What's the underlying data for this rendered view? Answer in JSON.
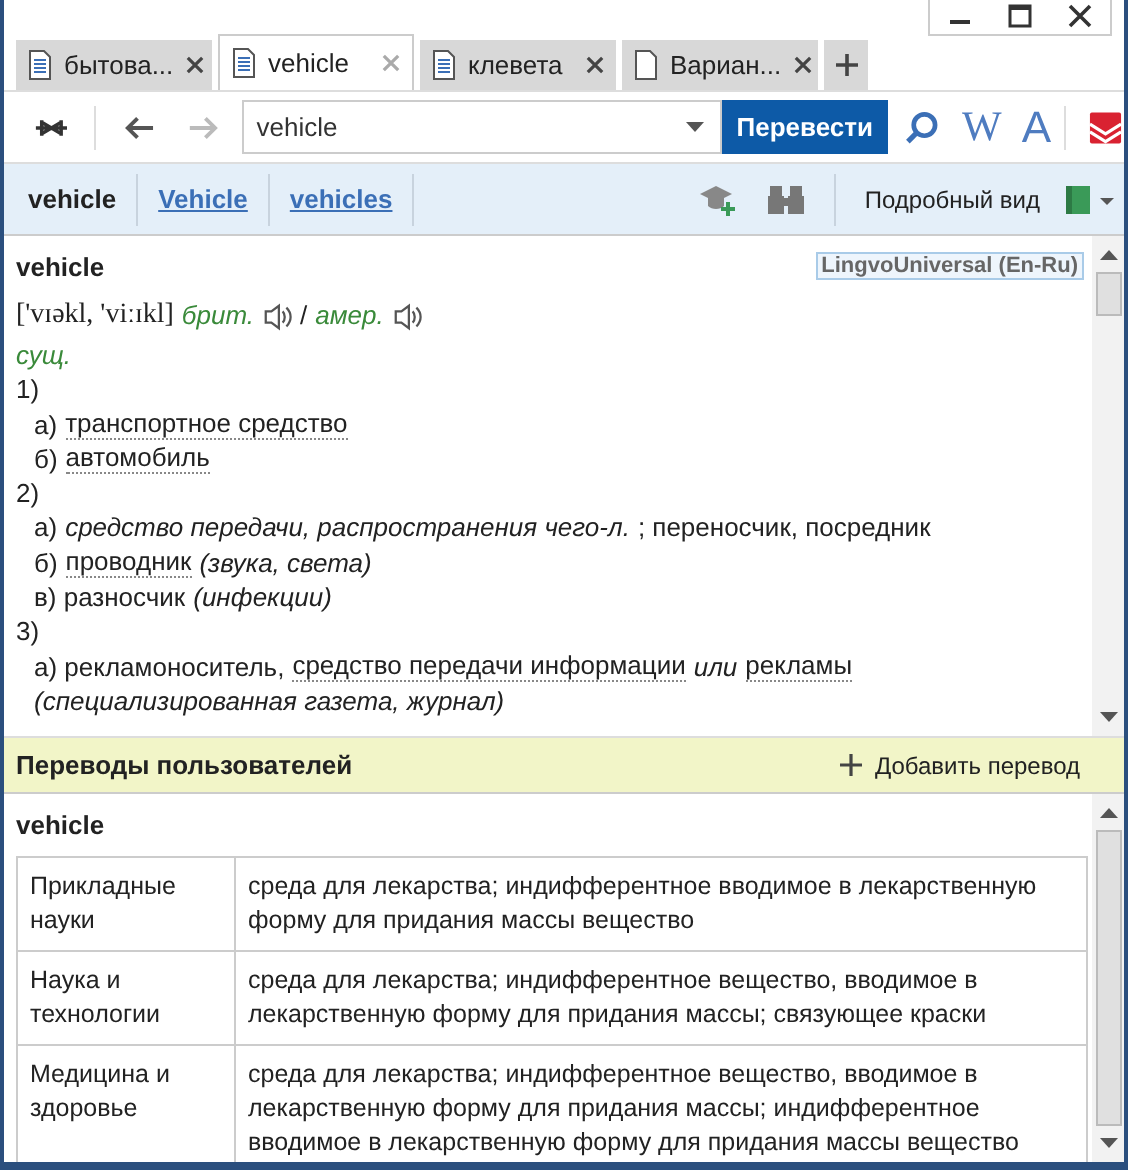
{
  "tabs": [
    {
      "label": "бытова...",
      "kind": "article",
      "selected": false
    },
    {
      "label": "vehicle",
      "kind": "article",
      "selected": true
    },
    {
      "label": "клевета",
      "kind": "article",
      "selected": false
    },
    {
      "label": "Вариан...",
      "kind": "blank",
      "selected": false
    }
  ],
  "toolbar": {
    "forward_disabled": true,
    "search": {
      "value": "vehicle"
    },
    "translate_button": "Перевести",
    "wiki_button": "W",
    "spell_button": "A"
  },
  "word_forms": [
    {
      "label": "vehicle",
      "selected": true
    },
    {
      "label": "Vehicle",
      "selected": false
    },
    {
      "label": "vehicles",
      "selected": false
    }
  ],
  "view_button": "Подробный вид",
  "article": {
    "headword": "vehicle",
    "dictionary": "LingvoUniversal (En-Ru)",
    "transcription": "['vɪəkl, 'viːɪkl]",
    "british": "брит.",
    "separator": "/",
    "american": "амер.",
    "lines": [
      {
        "indent": false,
        "segments": [
          {
            "kind": "label",
            "text": "сущ."
          }
        ]
      },
      {
        "indent": false,
        "segments": [
          {
            "kind": "text",
            "text": "1)"
          }
        ]
      },
      {
        "indent": true,
        "segments": [
          {
            "kind": "text",
            "text": "а)"
          },
          {
            "kind": "link",
            "text": "транспортное средство"
          }
        ]
      },
      {
        "indent": true,
        "segments": [
          {
            "kind": "text",
            "text": "б)"
          },
          {
            "kind": "link",
            "text": "автомобиль"
          }
        ]
      },
      {
        "indent": false,
        "segments": [
          {
            "kind": "text",
            "text": "2)"
          }
        ]
      },
      {
        "indent": true,
        "segments": [
          {
            "kind": "text",
            "text": "а)"
          },
          {
            "kind": "note",
            "text": "средство передачи, распространения чего-л."
          },
          {
            "kind": "text",
            "text": "; переносчик, посредник"
          }
        ]
      },
      {
        "indent": true,
        "segments": [
          {
            "kind": "text",
            "text": "б)"
          },
          {
            "kind": "link",
            "text": "проводник"
          },
          {
            "kind": "note",
            "text": "(звука, света)"
          }
        ]
      },
      {
        "indent": true,
        "segments": [
          {
            "kind": "text",
            "text": "в) разносчик"
          },
          {
            "kind": "note",
            "text": "(инфекции)"
          }
        ]
      },
      {
        "indent": false,
        "segments": [
          {
            "kind": "text",
            "text": "3)"
          }
        ]
      },
      {
        "indent": true,
        "segments": [
          {
            "kind": "text",
            "text": "а) рекламоноситель,"
          },
          {
            "kind": "link",
            "text": "средство передачи информации"
          },
          {
            "kind": "note",
            "text": "или"
          },
          {
            "kind": "link",
            "text": "рекламы"
          }
        ]
      },
      {
        "indent": true,
        "segments": [
          {
            "kind": "note",
            "text": "(специализированная газета, журнал)"
          }
        ]
      }
    ]
  },
  "user_translations": {
    "title": "Переводы пользователей",
    "add_button": "Добавить перевод",
    "headword": "vehicle",
    "rows": [
      {
        "field": "Прикладные науки",
        "translation": "среда для лекарства; индифферентное вводимое в лекарственную форму для придания массы вещество"
      },
      {
        "field": "Наука и технологии",
        "translation": "среда для лекарства; индифферентное вещество, вводимое в лекарственную форму для придания массы; связующее краски"
      },
      {
        "field": "Медицина и здоровье",
        "translation": "среда для лекарства; индифферентное вещество, вводимое в лекарственную форму для придания массы; индифферентное вводимое в лекарственную форму для придания массы вещество"
      }
    ]
  }
}
